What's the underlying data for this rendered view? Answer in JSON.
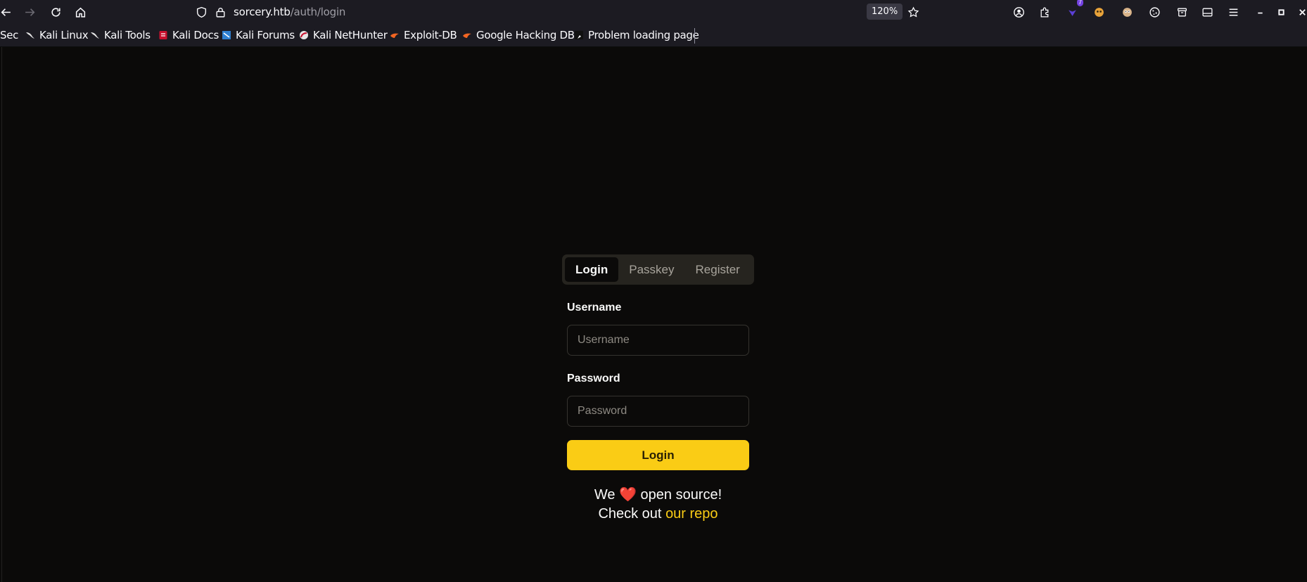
{
  "browser": {
    "url_host": "sorcery.htb",
    "url_path": "/auth/login",
    "zoom": "120%",
    "extension_badge": "7",
    "icons": [
      "back-icon",
      "forward-icon",
      "reload-icon",
      "home-icon",
      "shield-icon",
      "lock-icon",
      "star-icon",
      "account-icon",
      "extensions-icon",
      "privacy-icon",
      "ext-icon",
      "ext-face-icon",
      "cookie-icon",
      "container-icon",
      "sidebar-icon",
      "menu-icon",
      "minimize-icon",
      "maximize-icon",
      "close-icon"
    ]
  },
  "bookmarks": [
    {
      "label": "Sec",
      "icon": "none"
    },
    {
      "label": "Kali Linux",
      "icon": "kali-dragon-icon"
    },
    {
      "label": "Kali Tools",
      "icon": "kali-dragon-icon"
    },
    {
      "label": "Kali Docs",
      "icon": "kali-docs-icon"
    },
    {
      "label": "Kali Forums",
      "icon": "kali-forums-icon"
    },
    {
      "label": "Kali NetHunter",
      "icon": "nethunter-icon"
    },
    {
      "label": "Exploit-DB",
      "icon": "exploitdb-icon"
    },
    {
      "label": "Google Hacking DB",
      "icon": "ghdb-icon"
    },
    {
      "label": "Problem loading page",
      "icon": "page-icon"
    }
  ],
  "auth": {
    "tabs": [
      {
        "label": "Login",
        "active": true
      },
      {
        "label": "Passkey",
        "active": false
      },
      {
        "label": "Register",
        "active": false
      }
    ],
    "username_label": "Username",
    "username_placeholder": "Username",
    "username_value": "",
    "password_label": "Password",
    "password_placeholder": "Password",
    "password_value": "",
    "submit_label": "Login",
    "footer_line1_before": "We",
    "footer_heart": "❤️",
    "footer_line1_after": "open source!",
    "footer_line2_before": "Check out",
    "footer_link": "our repo"
  },
  "colors": {
    "accent": "#facc15",
    "background": "#0b0a09",
    "chrome": "#1c1b22"
  }
}
